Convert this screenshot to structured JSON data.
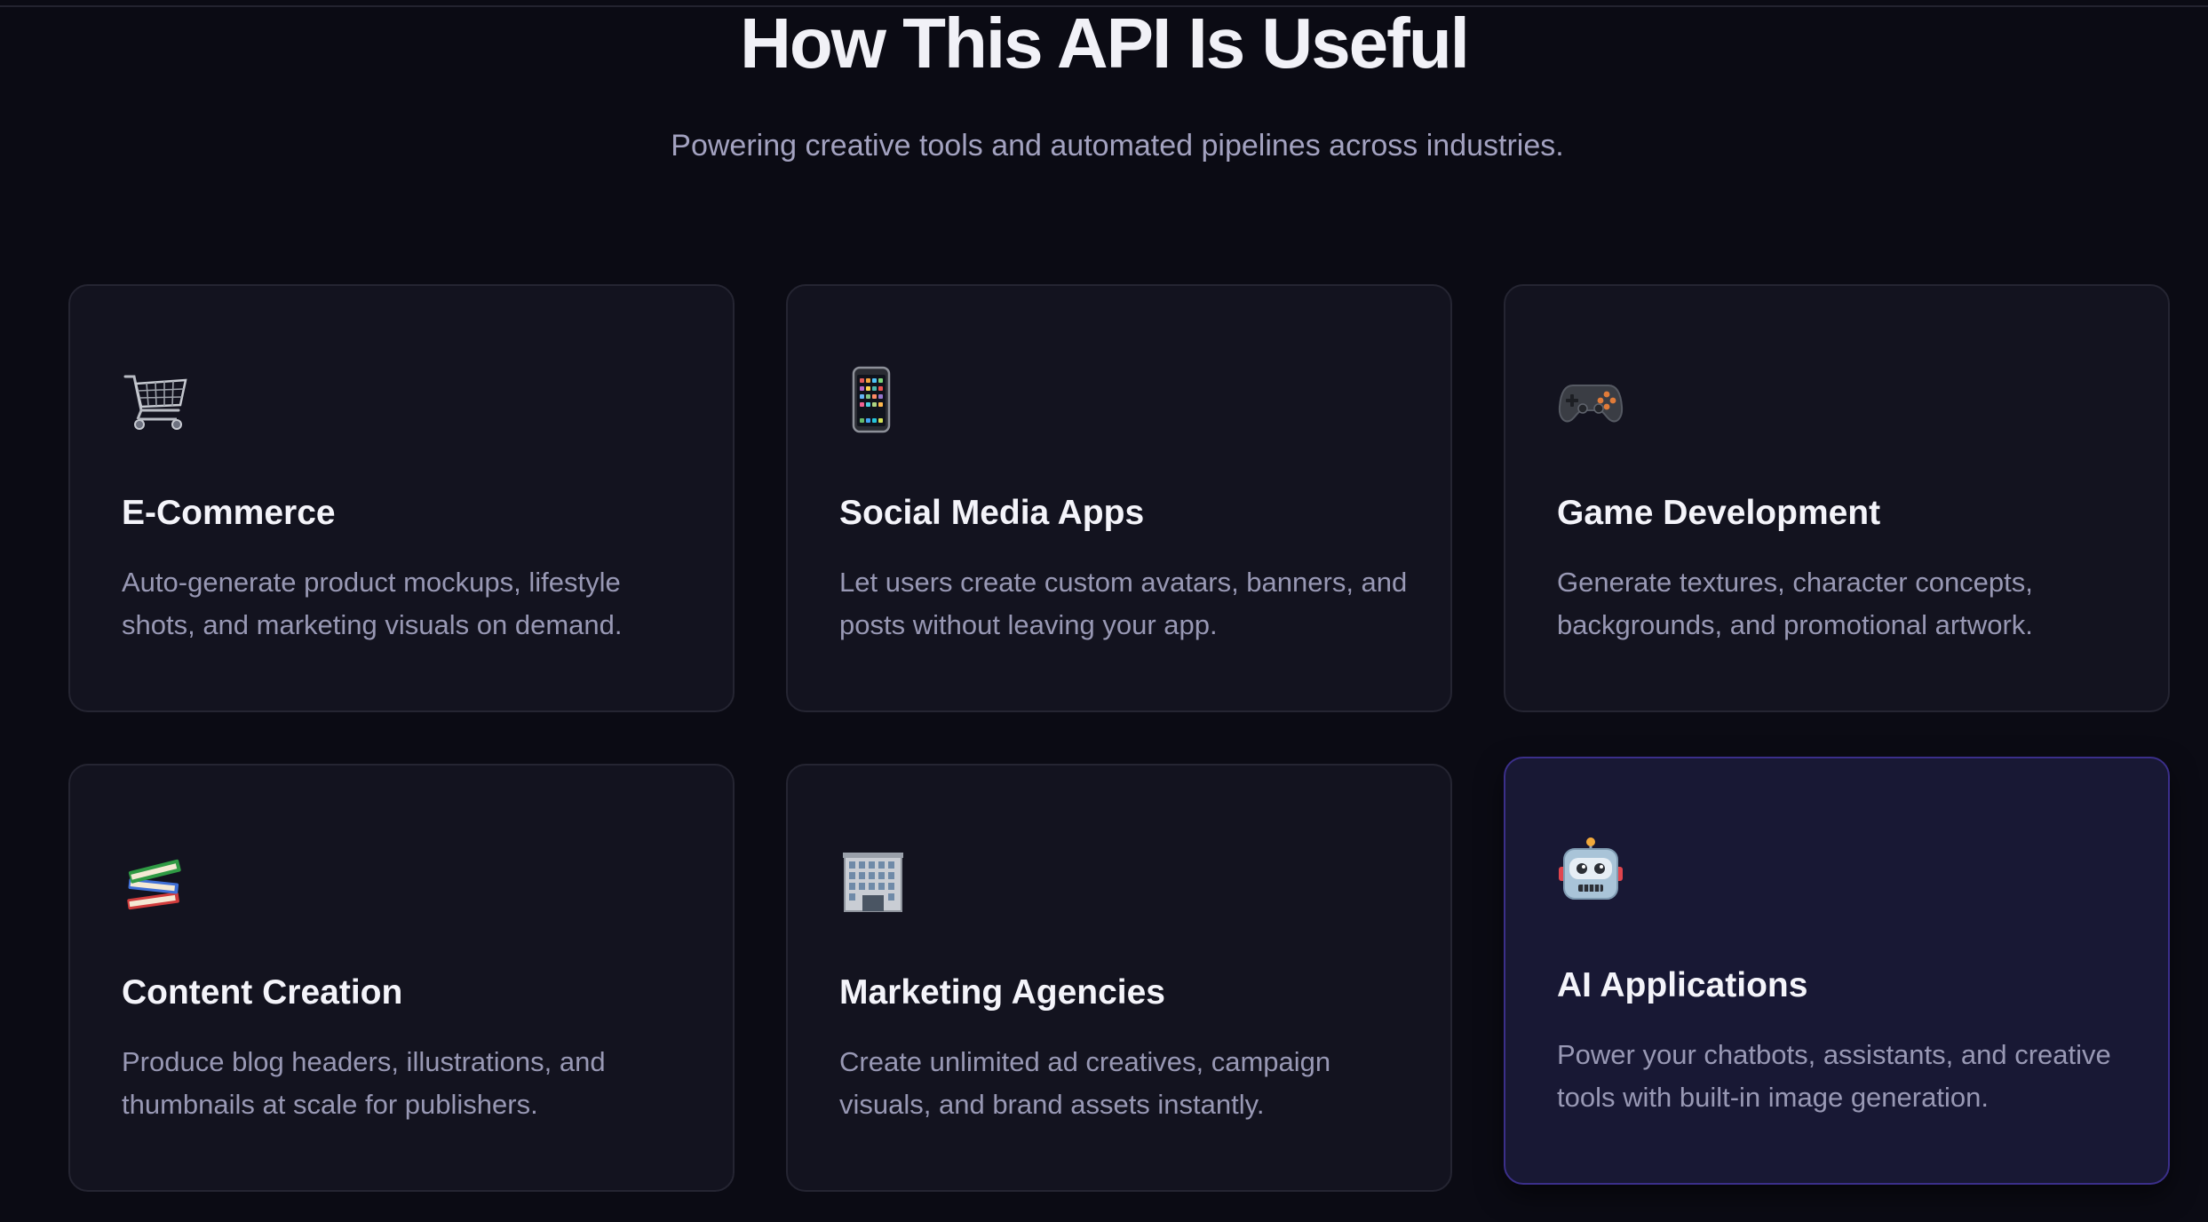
{
  "section": {
    "title": "How This API Is Useful",
    "subtitle": "Powering creative tools and automated pipelines across industries."
  },
  "cards": [
    {
      "icon": "shopping-cart-icon",
      "title": "E-Commerce",
      "description": "Auto-generate product mockups, lifestyle shots, and marketing visuals on demand."
    },
    {
      "icon": "mobile-phone-icon",
      "title": "Social Media Apps",
      "description": "Let users create custom avatars, banners, and posts without leaving your app."
    },
    {
      "icon": "game-controller-icon",
      "title": "Game Development",
      "description": "Generate textures, character concepts, backgrounds, and promotional artwork."
    },
    {
      "icon": "books-icon",
      "title": "Content Creation",
      "description": "Produce blog headers, illustrations, and thumbnails at scale for publishers."
    },
    {
      "icon": "office-building-icon",
      "title": "Marketing Agencies",
      "description": "Create unlimited ad creatives, campaign visuals, and brand assets instantly."
    },
    {
      "icon": "robot-icon",
      "title": "AI Applications",
      "description": "Power your chatbots, assistants, and creative tools with built-in image generation."
    }
  ],
  "colors": {
    "background": "#0b0b14",
    "card_background": "#13131f",
    "card_border": "#252532",
    "highlight_background": "#181834",
    "highlight_border": "#3b2f8a",
    "title_text": "#f1f1f7",
    "muted_text": "#9898b4"
  }
}
